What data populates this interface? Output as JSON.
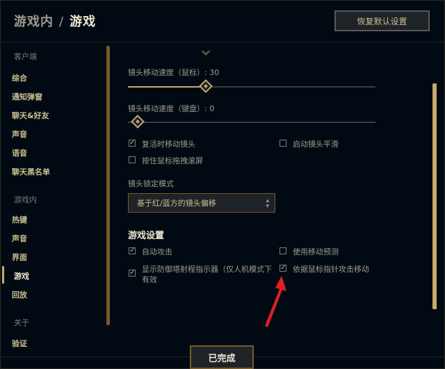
{
  "header": {
    "crumb_parent": "游戏内",
    "crumb_sep": "/",
    "crumb_current": "游戏",
    "restore_label": "恢复默认设置"
  },
  "sidebar": {
    "groups": [
      {
        "label": "客户端",
        "items": [
          "综合",
          "通知弹窗",
          "聊天&好友",
          "声音",
          "语音",
          "聊天黑名单"
        ]
      },
      {
        "label": "游戏内",
        "items": [
          "热键",
          "声音",
          "界面",
          "游戏",
          "回放"
        ]
      },
      {
        "label": "关于",
        "items": [
          "验证"
        ]
      }
    ],
    "active": "游戏"
  },
  "camera": {
    "mouse_speed_label": "镜头移动速度（鼠标）: 30",
    "mouse_speed_value": 30,
    "keyboard_speed_label": "镜头移动速度（键盘）: 0",
    "keyboard_speed_value": 0,
    "options": [
      {
        "label": "复活时移动镜头",
        "checked": true
      },
      {
        "label": "启动镜头平滑",
        "checked": false
      },
      {
        "label": "按住鼠标拖拽滚屏",
        "checked": false
      }
    ],
    "lock_mode_label": "镜头锁定模式",
    "lock_mode_value": "基于红/蓝方的镜头偏移"
  },
  "game": {
    "section_title": "游戏设置",
    "options": [
      {
        "label": "自动攻击",
        "checked": true
      },
      {
        "label": "使用移动预测",
        "checked": false
      },
      {
        "label": "显示防御塔射程指示器（仅人机模式下有效",
        "checked": true
      },
      {
        "label": "依据鼠标指针攻击移动",
        "checked": true
      }
    ],
    "tower_line1": "显示防御塔射程指示器（仅人机模式下",
    "tower_line2": "有效"
  },
  "footer": {
    "done_label": "已完成"
  },
  "colors": {
    "gold": "#c8aa6e",
    "text": "#a09b8c",
    "bg": "#010a13",
    "arrow": "#e02020"
  }
}
